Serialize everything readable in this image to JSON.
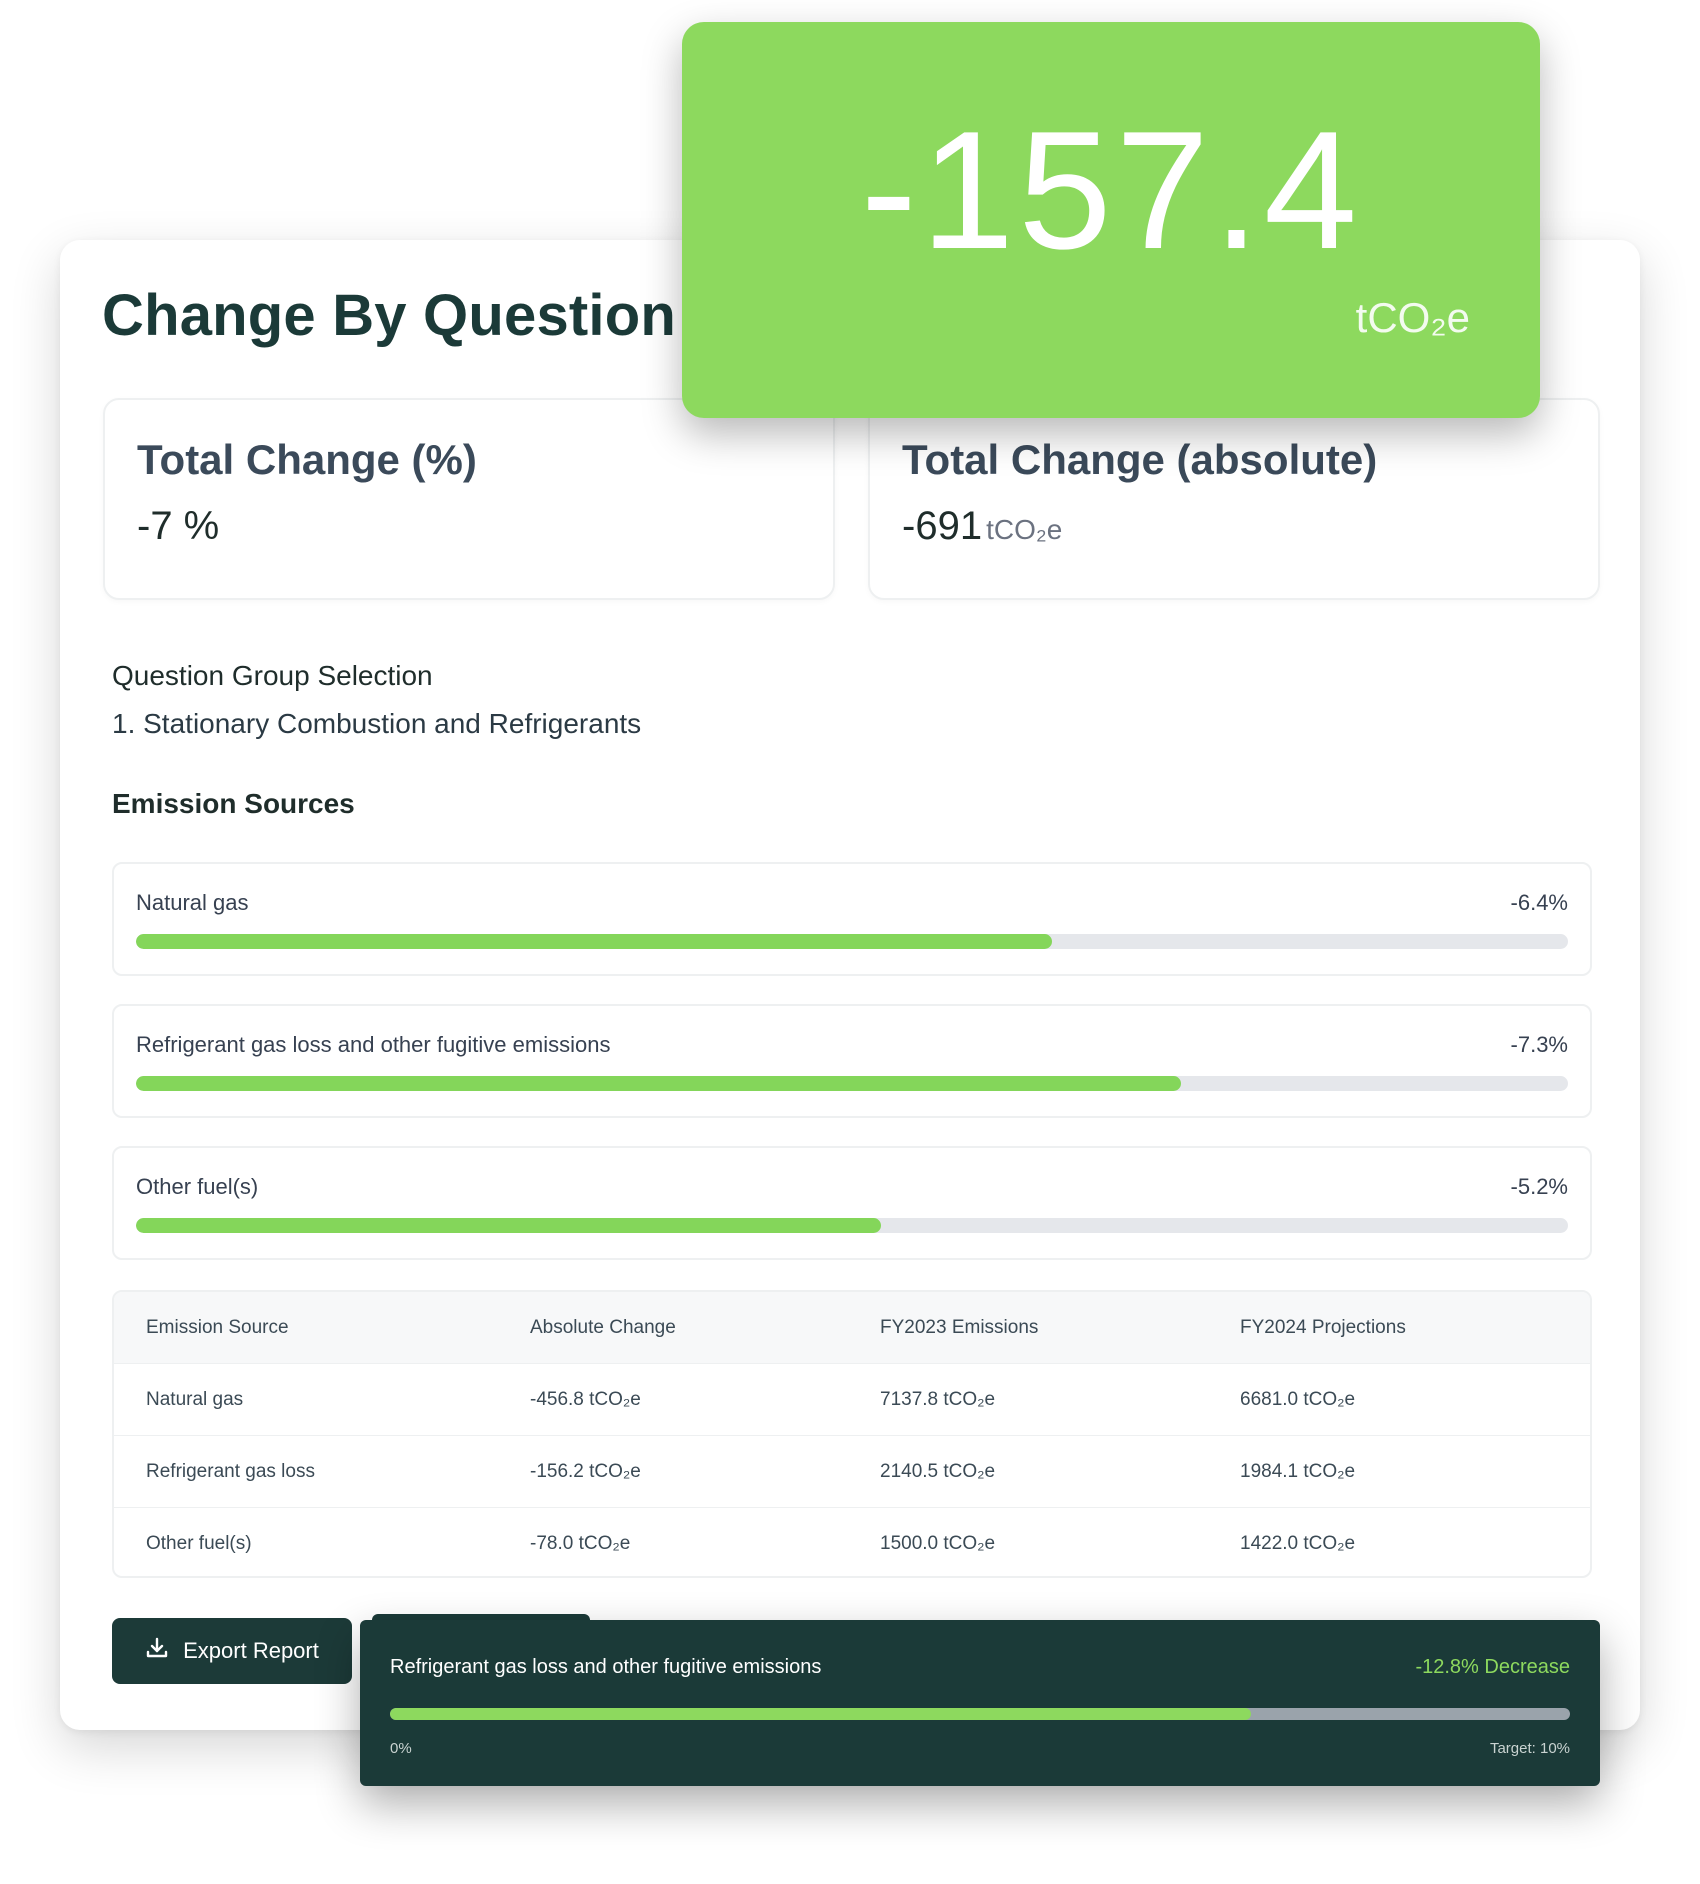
{
  "page_title": "Change By Question Group",
  "stats": {
    "pct": {
      "label": "Total Change (%)",
      "value": "-7 %"
    },
    "abs": {
      "label": "Total Change (absolute)",
      "value": "-691",
      "unit": "tCO₂e"
    }
  },
  "question_group": {
    "label": "Question Group Selection",
    "value": "1. Stationary Combustion and Refrigerants"
  },
  "emission_sources": {
    "label": "Emission Sources",
    "items": [
      {
        "name": "Natural gas",
        "change": "-6.4%",
        "progress": 0.64
      },
      {
        "name": "Refrigerant gas loss and other fugitive emissions",
        "change": "-7.3%",
        "progress": 0.73
      },
      {
        "name": "Other fuel(s)",
        "change": "-5.2%",
        "progress": 0.52
      }
    ]
  },
  "table": {
    "headers": [
      "Emission Source",
      "Absolute Change",
      "FY2023 Emissions",
      "FY2024 Projections"
    ],
    "rows": [
      [
        "Natural gas",
        "-456.8 tCO₂e",
        "7137.8 tCO₂e",
        "6681.0 tCO₂e"
      ],
      [
        "Refrigerant gas loss",
        "-156.2 tCO₂e",
        "2140.5 tCO₂e",
        "1984.1 tCO₂e"
      ],
      [
        "Other fuel(s)",
        "-78.0 tCO₂e",
        "1500.0 tCO₂e",
        "1422.0 tCO₂e"
      ]
    ]
  },
  "export_button": {
    "label": "Export Report",
    "icon": "download-icon"
  },
  "highlight_card": {
    "value": "-157.4",
    "unit": "tCO₂e",
    "color": "#8dd95e"
  },
  "tooltip_card": {
    "title": "Refrigerant gas loss and other fugitive emissions",
    "status": "-12.8% Decrease",
    "progress": 0.73,
    "min_label": "0%",
    "max_label": "Target: 10%"
  },
  "colors": {
    "accent": "#8dd95e",
    "dark": "#1b3a38",
    "track": "#e5e7eb"
  }
}
